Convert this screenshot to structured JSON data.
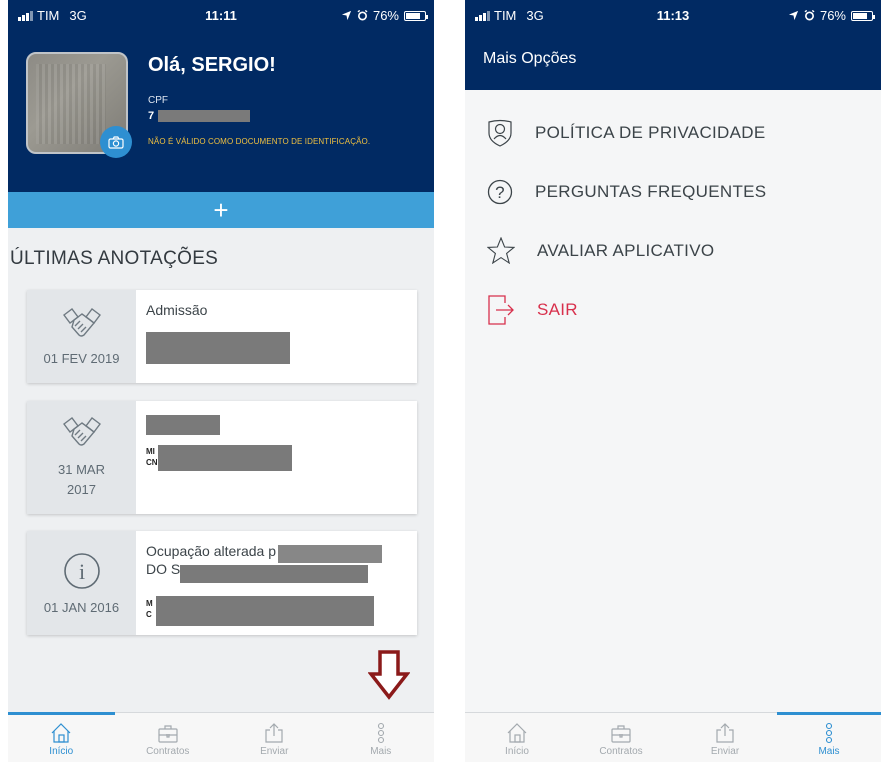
{
  "left": {
    "status": {
      "carrier": "TIM",
      "network": "3G",
      "time": "11:11",
      "battery": "76%",
      "battery_level": 0.76
    },
    "header": {
      "greeting": "Olá, SERGIO!",
      "cpf_label": "CPF",
      "cpf_prefix": "7",
      "disclaimer": "NÃO É VÁLIDO COMO DOCUMENTO DE IDENTIFICAÇÃO."
    },
    "add_button_label": "+",
    "section_title": "ÚLTIMAS ANOTAÇÕES",
    "annotations": [
      {
        "date": "01 FEV 2019",
        "title": "Admissão",
        "icon": "handshake-icon"
      },
      {
        "date": "31 MAR 2017",
        "line1": "MI",
        "line2": "CN",
        "icon": "handshake-icon"
      },
      {
        "date": "01 JAN 2016",
        "title": "Ocupação alterada p",
        "title_cont": "DO S",
        "line1": "M",
        "line2": "C",
        "icon": "info-icon"
      }
    ],
    "tabs": [
      {
        "label": "Início",
        "icon": "home-icon",
        "active": true
      },
      {
        "label": "Contratos",
        "icon": "briefcase-icon",
        "active": false
      },
      {
        "label": "Enviar",
        "icon": "share-icon",
        "active": false
      },
      {
        "label": "Mais",
        "icon": "more-icon",
        "active": false
      }
    ]
  },
  "right": {
    "status": {
      "carrier": "TIM",
      "network": "3G",
      "time": "11:13",
      "battery": "76%",
      "battery_level": 0.76
    },
    "title": "Mais Opções",
    "menu": [
      {
        "label": "POLÍTICA DE PRIVACIDADE",
        "icon": "privacy-shield-icon"
      },
      {
        "label": "PERGUNTAS FREQUENTES",
        "icon": "question-icon"
      },
      {
        "label": "AVALIAR APLICATIVO",
        "icon": "star-icon"
      },
      {
        "label": "SAIR",
        "icon": "logout-icon"
      }
    ],
    "tabs": [
      {
        "label": "Início",
        "icon": "home-icon",
        "active": false
      },
      {
        "label": "Contratos",
        "icon": "briefcase-icon",
        "active": false
      },
      {
        "label": "Enviar",
        "icon": "share-icon",
        "active": false
      },
      {
        "label": "Mais",
        "icon": "more-icon",
        "active": true
      }
    ]
  },
  "colors": {
    "navy": "#012a63",
    "accent": "#2e8fd1",
    "add_bar": "#3fa0d8",
    "danger": "#d8304c",
    "arrow": "#8b1a1a",
    "highlight": "#f0c040"
  }
}
